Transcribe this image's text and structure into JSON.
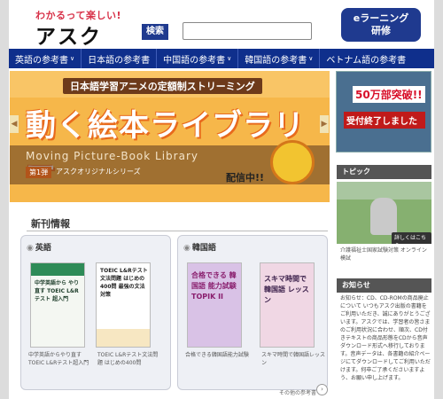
{
  "header": {
    "tagline": "わかるって楽しい!",
    "logo": "アスク",
    "search_button": "検索",
    "search_placeholder": "",
    "elearning_line1": "eラーニング",
    "elearning_line2": "研修"
  },
  "nav": {
    "items": [
      {
        "label": "英語の参考書",
        "dropdown": true
      },
      {
        "label": "日本語の参考書",
        "dropdown": false
      },
      {
        "label": "中国語の参考書",
        "dropdown": true
      },
      {
        "label": "韓国語の参考書",
        "dropdown": true
      },
      {
        "label": "ベトナム語の参考書",
        "dropdown": false
      }
    ]
  },
  "hero": {
    "subtitle": "日本語学習アニメの定額制ストリーミング",
    "title": "動く絵本ライブラリー",
    "english_title": "Moving Picture-Book Library",
    "badge": "第1弾",
    "series": "アスクオリジナルシリーズ",
    "on_air": "配信中!!"
  },
  "new_releases": {
    "title": "新刊情報",
    "more_label": "その他の参考書",
    "groups": [
      {
        "name": "英語",
        "books": [
          {
            "cover_text": "中学英語から やり直す TOEIC L&Rテスト 超入門",
            "caption": "中学英語からやり直す TOEIC L&Rテスト超入門",
            "cover_color": "#f4f7f2",
            "accent": "#2e8b57"
          },
          {
            "cover_text": "TOEIC L&Rテスト 文法問題 はじめの400問 最強の文法対策",
            "caption": "TOEIC L&Rテスト文法問題 はじめの400問",
            "cover_color": "#ffffff",
            "accent": "#e8a01a"
          }
        ]
      },
      {
        "name": "韓国語",
        "books": [
          {
            "cover_text": "合格できる 韓国語 能力試験 TOPIK II",
            "caption": "合格できる韓国語能力試験",
            "cover_color": "#d9c2e6",
            "accent": "#b03a8a"
          },
          {
            "cover_text": "スキマ時間で 韓国語 レッスン",
            "caption": "スキマ時間で韓国語レッスン",
            "cover_color": "#f0d7e4",
            "accent": "#6a2b8a"
          }
        ]
      }
    ]
  },
  "sidebar": {
    "ad_headline": "50万部突破!!",
    "ad_banner": "受付終了しました",
    "topics_title": "トピック",
    "photo_link": "詳しくはこちら",
    "photo_caption": "介護福祉士国家試験対策 オンライン模試",
    "notice_title": "お知らせ",
    "notice_text": "お知らせ：CD、CD-ROMの商品廃止について いつもアスク出版の書籍をご利用いただき、誠にありがとうございます。アスクでは、学習者の皆さまのご利用状況に合わせ、順次、CD付きテキストの商品形態をCDから音声ダウンロード形式へ移行しております。音声データは、各書籍の紹介ページにてダウンロードしてご利用いただけます。何卒ご了承くださいますよう、お願い申し上げます。"
  },
  "colors": {
    "nav_bg": "#0f2f8c",
    "brand_blue": "#1f3a8f",
    "tagline_red": "#d8334a",
    "hero_bg": "#f6b74a"
  }
}
